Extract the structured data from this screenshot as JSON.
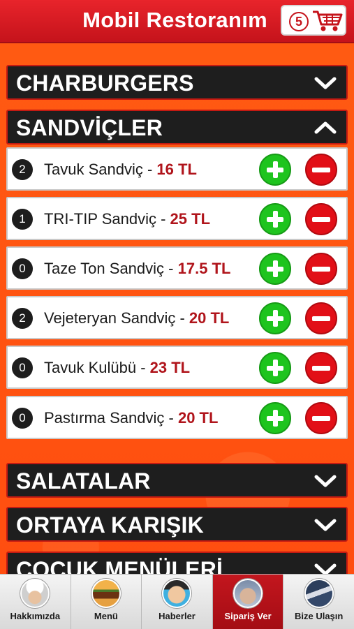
{
  "header": {
    "title": "Mobil Restoranım",
    "cart_count": "5",
    "cart_icon": "shopping-cart-icon",
    "colors": {
      "bar": "#d11a21",
      "accent": "#c5131b"
    }
  },
  "categories": [
    {
      "label": "CHARBURGERS",
      "state": "collapsed",
      "icon": "chevron-down-icon"
    },
    {
      "label": "SANDVİÇLER",
      "state": "expanded",
      "icon": "chevron-up-icon"
    },
    {
      "label": "SALATALAR",
      "state": "collapsed",
      "icon": "chevron-down-icon"
    },
    {
      "label": "ORTAYA KARIŞIK",
      "state": "collapsed",
      "icon": "chevron-down-icon"
    },
    {
      "label": "ÇOCUK MENÜLERİ",
      "state": "collapsed",
      "icon": "chevron-down-icon"
    }
  ],
  "items": [
    {
      "qty": "2",
      "name": "Tavuk Sandviç",
      "sep": " - ",
      "price": "16 TL"
    },
    {
      "qty": "1",
      "name": "TRI-TIP Sandviç",
      "sep": " - ",
      "price": "25 TL"
    },
    {
      "qty": "0",
      "name": "Taze Ton Sandviç",
      "sep": " - ",
      "price": "17.5 TL"
    },
    {
      "qty": "2",
      "name": "Vejeteryan Sandviç",
      "sep": " - ",
      "price": "20 TL"
    },
    {
      "qty": "0",
      "name": "Tavuk Kulübü",
      "sep": " - ",
      "price": "23 TL"
    },
    {
      "qty": "0",
      "name": "Pastırma Sandviç",
      "sep": " - ",
      "price": "20 TL"
    }
  ],
  "tabs": [
    {
      "label": "Hakkımızda",
      "icon": "chef-avatar-icon",
      "active": false
    },
    {
      "label": "Menü",
      "icon": "burger-icon",
      "active": false
    },
    {
      "label": "Haberler",
      "icon": "news-avatar-icon",
      "active": false
    },
    {
      "label": "Sipariş Ver",
      "icon": "order-icon",
      "active": true
    },
    {
      "label": "Bize Ulaşın",
      "icon": "contact-icon",
      "active": false
    }
  ],
  "colors": {
    "background": "#ff5a12",
    "category_bg": "#1e1e1e",
    "price": "#b0141b",
    "add": "#1ec41e",
    "remove": "#e20f17",
    "active_tab": "#b3111a"
  }
}
